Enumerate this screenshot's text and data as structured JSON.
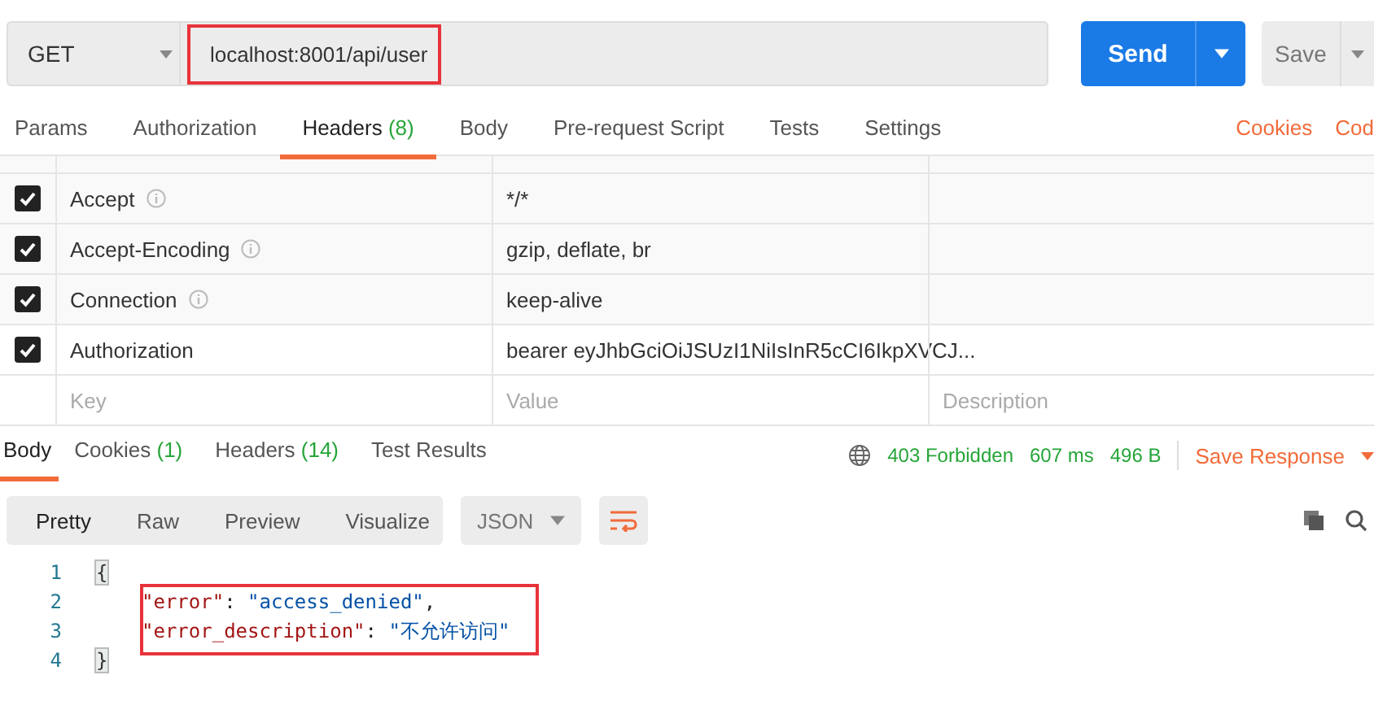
{
  "request": {
    "method": "GET",
    "url": "localhost:8001/api/user",
    "url_highlighted": true,
    "send": "Send",
    "save": "Save"
  },
  "request_tabs": [
    {
      "label": "Params",
      "selected": false
    },
    {
      "label": "Authorization",
      "selected": false
    },
    {
      "label": "Headers",
      "count": "(8)",
      "selected": true
    },
    {
      "label": "Body",
      "selected": false
    },
    {
      "label": "Pre-request Script",
      "selected": false
    },
    {
      "label": "Tests",
      "selected": false
    },
    {
      "label": "Settings",
      "selected": false
    }
  ],
  "request_links": [
    "Cookies",
    "Cod"
  ],
  "headers": [
    {
      "key": "Accept",
      "value": "*/*",
      "checked": true,
      "info": true
    },
    {
      "key": "Accept-Encoding",
      "value": "gzip, deflate, br",
      "checked": true,
      "info": true
    },
    {
      "key": "Connection",
      "value": "keep-alive",
      "checked": true,
      "info": true
    },
    {
      "key": "Authorization",
      "value": "bearer eyJhbGciOiJSUzI1NiIsInR5cCI6IkpXVCJ...",
      "checked": true,
      "info": false
    }
  ],
  "new_header": {
    "key": "Key",
    "value": "Value",
    "description": "Description"
  },
  "response_tabs": [
    {
      "label": "Body",
      "selected": true
    },
    {
      "label": "Cookies",
      "count": "(1)",
      "selected": false
    },
    {
      "label": "Headers",
      "count": "(14)",
      "selected": false
    },
    {
      "label": "Test Results",
      "selected": false
    }
  ],
  "response_status": {
    "status": "403 Forbidden",
    "time": "607 ms",
    "size": "496 B",
    "save": "Save Response"
  },
  "view_modes": [
    {
      "label": "Pretty",
      "selected": true
    },
    {
      "label": "Raw",
      "selected": false
    },
    {
      "label": "Preview",
      "selected": false
    },
    {
      "label": "Visualize",
      "selected": false
    }
  ],
  "format": "JSON",
  "code": [
    {
      "number": "1",
      "highlighted": false,
      "tokens": [
        {
          "kind": "brace",
          "text": "{"
        }
      ]
    },
    {
      "number": "2",
      "highlighted": true,
      "tokens": [
        {
          "kind": "key",
          "text": "\"error\""
        },
        {
          "kind": "punct",
          "text": ": "
        },
        {
          "kind": "string",
          "text": "\"access_denied\""
        },
        {
          "kind": "punct",
          "text": ","
        }
      ]
    },
    {
      "number": "3",
      "highlighted": true,
      "tokens": [
        {
          "kind": "key",
          "text": "\"error_description\""
        },
        {
          "kind": "punct",
          "text": ": "
        },
        {
          "kind": "string",
          "text": "\"不允许访问\""
        }
      ]
    },
    {
      "number": "4",
      "highlighted": false,
      "tokens": [
        {
          "kind": "brace",
          "text": "}"
        }
      ]
    }
  ]
}
